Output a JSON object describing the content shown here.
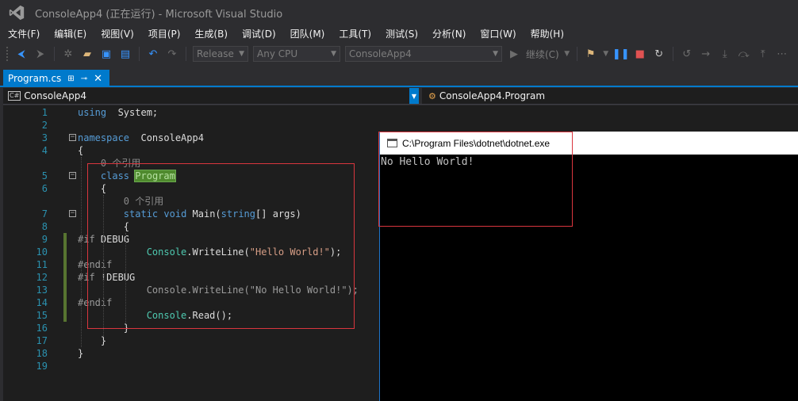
{
  "window": {
    "title": "ConsoleApp4 (正在运行) - Microsoft Visual Studio"
  },
  "menu": [
    "文件(F)",
    "编辑(E)",
    "视图(V)",
    "项目(P)",
    "生成(B)",
    "调试(D)",
    "团队(M)",
    "工具(T)",
    "测试(S)",
    "分析(N)",
    "窗口(W)",
    "帮助(H)"
  ],
  "toolbar": {
    "configuration": "Release",
    "platform": "Any CPU",
    "startup_project": "ConsoleApp4",
    "continue_label": "继续(C)"
  },
  "document_tab": {
    "label": "Program.cs"
  },
  "navbar": {
    "project": "ConsoleApp4",
    "type": "ConsoleApp4.Program",
    "lang_badge": "C#"
  },
  "editor": {
    "lines": [
      {
        "n": "1",
        "parts": [
          [
            "kw",
            "using"
          ],
          [
            "",
            "  System;"
          ]
        ]
      },
      {
        "n": "2",
        "parts": []
      },
      {
        "n": "3",
        "parts": [
          [
            "kw",
            "namespace"
          ],
          [
            "",
            "  ConsoleApp4"
          ]
        ]
      },
      {
        "n": "4",
        "parts": [
          [
            "",
            "{"
          ]
        ]
      },
      {
        "n": "",
        "parts": [
          [
            "dim",
            "    0 个引用"
          ]
        ]
      },
      {
        "n": "5",
        "parts": [
          [
            "",
            "    "
          ],
          [
            "kw",
            "class"
          ],
          [
            "",
            " "
          ],
          [
            "hl",
            "Program"
          ]
        ]
      },
      {
        "n": "6",
        "parts": [
          [
            "",
            "    {"
          ]
        ]
      },
      {
        "n": "",
        "parts": [
          [
            "dim",
            "        0 个引用"
          ]
        ]
      },
      {
        "n": "7",
        "parts": [
          [
            "",
            "        "
          ],
          [
            "kw",
            "static"
          ],
          [
            "",
            " "
          ],
          [
            "kw",
            "void"
          ],
          [
            "",
            " Main("
          ],
          [
            "kw",
            "string"
          ],
          [
            "",
            "[] args)"
          ]
        ]
      },
      {
        "n": "8",
        "parts": [
          [
            "",
            "        {"
          ]
        ]
      },
      {
        "n": "9",
        "parts": [
          [
            "pp",
            "#if"
          ],
          [
            "",
            " DEBUG"
          ]
        ]
      },
      {
        "n": "10",
        "parts": [
          [
            "",
            "            "
          ],
          [
            "ty",
            "Console"
          ],
          [
            "",
            ".WriteLine("
          ],
          [
            "str",
            "\"Hello World!\""
          ],
          [
            "",
            ");"
          ]
        ]
      },
      {
        "n": "11",
        "parts": [
          [
            "pp",
            "#endif"
          ]
        ]
      },
      {
        "n": "12",
        "parts": [
          [
            "pp",
            "#if"
          ],
          [
            "",
            " !DEBUG"
          ]
        ]
      },
      {
        "n": "13",
        "parts": [
          [
            "pp",
            "            Console.WriteLine(\"No Hello World!\");"
          ]
        ]
      },
      {
        "n": "14",
        "parts": [
          [
            "pp",
            "#endif"
          ]
        ]
      },
      {
        "n": "15",
        "parts": [
          [
            "",
            "            "
          ],
          [
            "ty",
            "Console"
          ],
          [
            "",
            ".Read();"
          ]
        ]
      },
      {
        "n": "16",
        "parts": [
          [
            "",
            "        }"
          ]
        ]
      },
      {
        "n": "17",
        "parts": [
          [
            "",
            "    }"
          ]
        ]
      },
      {
        "n": "18",
        "parts": [
          [
            "",
            "}"
          ]
        ]
      },
      {
        "n": "19",
        "parts": []
      }
    ]
  },
  "console": {
    "title": "C:\\Program Files\\dotnet\\dotnet.exe",
    "output": "No Hello World!"
  },
  "colors": {
    "accent": "#007acc",
    "keyword": "#569cd6",
    "type": "#4ec9b0",
    "string": "#d69d85",
    "line_number": "#2b91af",
    "annotation_box": "#d9363e"
  }
}
